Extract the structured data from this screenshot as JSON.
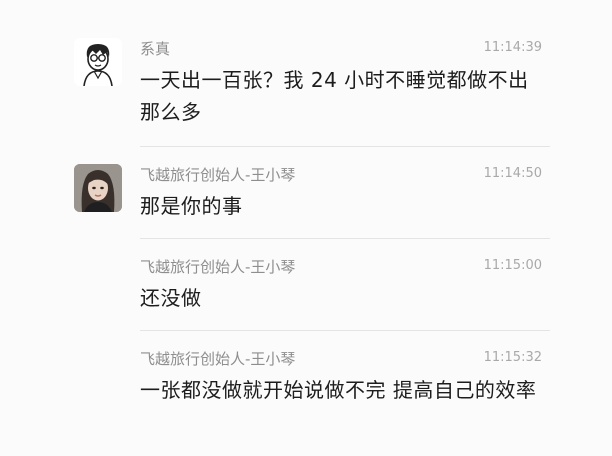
{
  "messages": [
    {
      "sender": "系真",
      "time": "11:14:39",
      "text": "一天出一百张？我 24 小时不睡觉都做不出那么多",
      "avatar": "cartoon-boy-avatar"
    },
    {
      "sender": "飞越旅行创始人-王小琴",
      "time": "11:14:50",
      "text": "那是你的事",
      "avatar": "woman-photo-avatar"
    },
    {
      "sender": "飞越旅行创始人-王小琴",
      "time": "11:15:00",
      "text": "还没做"
    },
    {
      "sender": "飞越旅行创始人-王小琴",
      "time": "11:15:32",
      "text": "一张都没做就开始说做不完 提高自己的效率"
    }
  ]
}
